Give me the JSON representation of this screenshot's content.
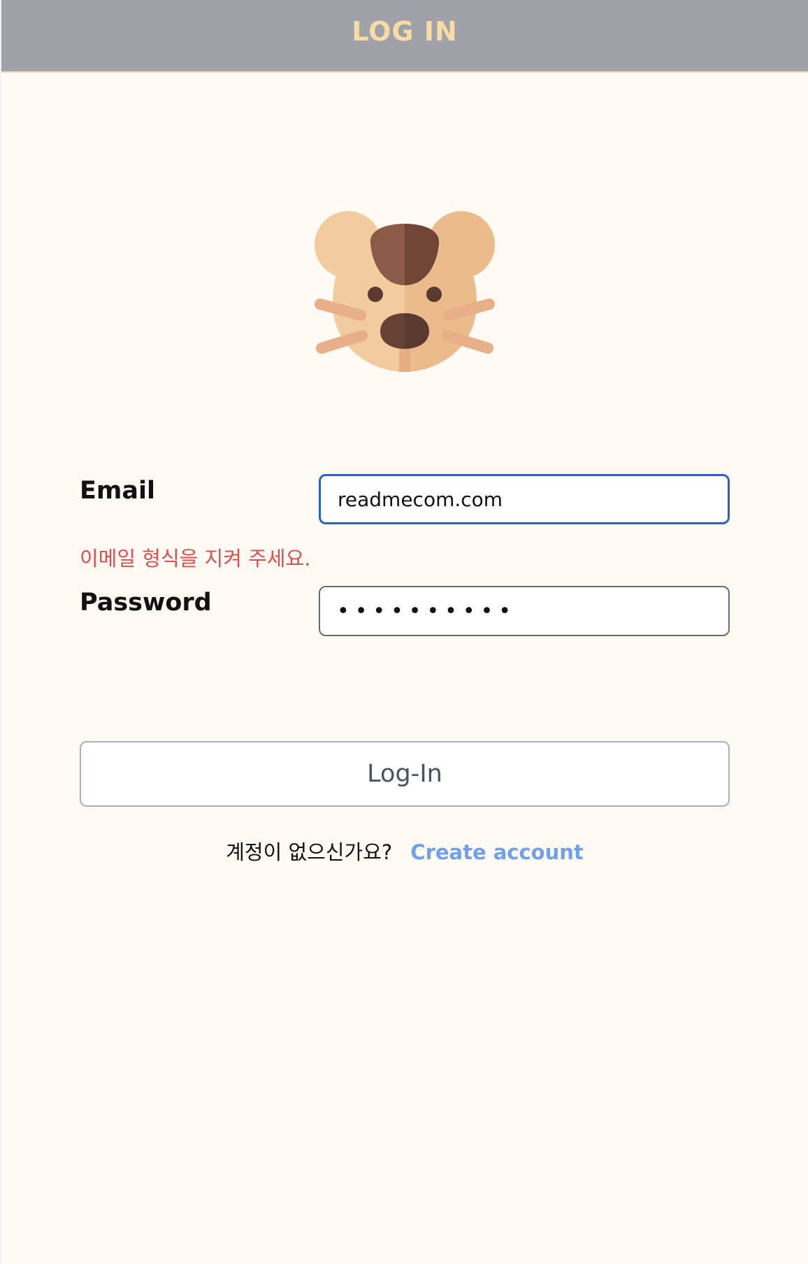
{
  "header": {
    "title": "LOG IN"
  },
  "logo": {
    "icon": "hamster-face-icon",
    "colors": {
      "fur_light": "#f2cc9e",
      "fur_dark": "#ecbb8c",
      "patch_light": "#8b5a48",
      "patch_dark": "#704637",
      "nose": "#5b3b2f",
      "whisker": "#e8ad84"
    }
  },
  "form": {
    "email": {
      "label": "Email",
      "value": "readmecom.com",
      "error": "이메일 형식을 지켜 주세요."
    },
    "password": {
      "label": "Password",
      "value": "••••••••••"
    },
    "submit_label": "Log-In"
  },
  "signup": {
    "question": "계정이 없으신가요?",
    "link_label": "Create account"
  },
  "colors": {
    "header_bg": "#a0a1a9",
    "header_text": "#f8dba6",
    "page_bg": "#fffaf3",
    "focus_border": "#2d5fc4",
    "error_text": "#dd4f4f",
    "link_text": "#6fa0ea"
  }
}
